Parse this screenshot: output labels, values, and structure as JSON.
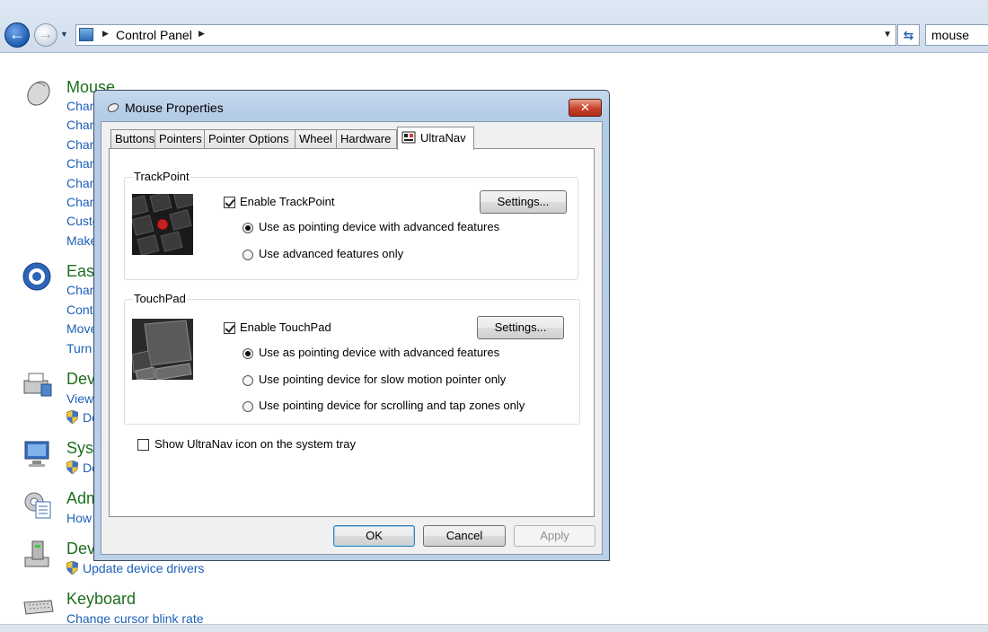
{
  "explorer": {
    "breadcrumb": [
      "Control Panel"
    ],
    "search_value": "mouse"
  },
  "results": [
    {
      "title": "Mouse",
      "icon": "mouse-icon",
      "links": [
        "Chan",
        "Chan",
        "Chan",
        "Chan",
        "Chan",
        "Chan",
        "Custo",
        "Make"
      ]
    },
    {
      "title": "Ease",
      "icon": "ease-of-access-icon",
      "links": [
        "Chan",
        "Contr",
        "Move",
        "Turn"
      ]
    },
    {
      "title": "Dev",
      "icon": "devices-printers-icon",
      "links": [
        "View",
        "De"
      ]
    },
    {
      "title": "Syst",
      "icon": "system-icon",
      "links": [
        "De"
      ]
    },
    {
      "title": "Adm",
      "icon": "admin-tools-icon",
      "links": [
        "How"
      ]
    },
    {
      "title": "Dev",
      "icon": "device-manager-icon",
      "links": [
        "Update device drivers"
      ]
    },
    {
      "title": "Keyboard",
      "icon": "keyboard-icon",
      "links": [
        "Change cursor blink rate"
      ]
    }
  ],
  "dialog": {
    "title": "Mouse Properties",
    "close_symbol": "✕",
    "tabs": [
      "Buttons",
      "Pointers",
      "Pointer Options",
      "Wheel",
      "Hardware",
      "UltraNav"
    ],
    "active_tab": "UltraNav",
    "trackpoint": {
      "legend": "TrackPoint",
      "enable_label": "Enable TrackPoint",
      "enabled": true,
      "settings_label": "Settings...",
      "options": [
        {
          "label": "Use as pointing device with advanced features",
          "selected": true
        },
        {
          "label": "Use advanced features only",
          "selected": false
        }
      ]
    },
    "touchpad": {
      "legend": "TouchPad",
      "enable_label": "Enable TouchPad",
      "enabled": true,
      "settings_label": "Settings...",
      "options": [
        {
          "label": "Use as pointing device with advanced features",
          "selected": true
        },
        {
          "label": "Use pointing device for slow motion pointer only",
          "selected": false
        },
        {
          "label": "Use pointing device for scrolling and tap zones only",
          "selected": false
        }
      ]
    },
    "tray_label": "Show UltraNav icon on the system tray",
    "tray_checked": false,
    "buttons": {
      "ok": "OK",
      "cancel": "Cancel",
      "apply": "Apply"
    }
  }
}
